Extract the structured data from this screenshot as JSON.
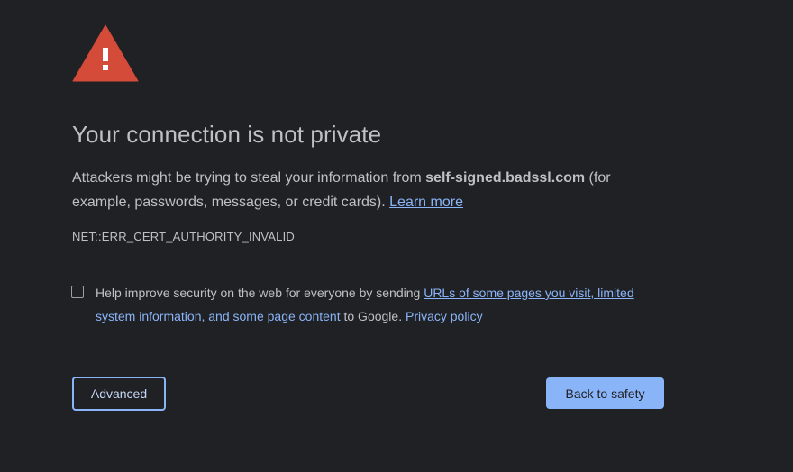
{
  "icon": {
    "name": "warning-triangle-icon",
    "color": "#d44b3a"
  },
  "title": "Your connection is not private",
  "message": {
    "before": "Attackers might be trying to steal your information from ",
    "host": "self-signed.badssl.com",
    "after": " (for example, passwords, messages, or credit cards). ",
    "learn_more": "Learn more"
  },
  "error_code": "NET::ERR_CERT_AUTHORITY_INVALID",
  "optin": {
    "checked": false,
    "text_before": "Help improve security on the web for everyone by sending ",
    "link_urls": "URLs of some pages you visit, limited system information, and some page content",
    "text_middle": " to Google. ",
    "link_privacy": "Privacy policy"
  },
  "buttons": {
    "advanced": "Advanced",
    "back_to_safety": "Back to safety"
  },
  "colors": {
    "background": "#202124",
    "text": "#bdc1c6",
    "link": "#8ab4f8",
    "primary_button": "#8ab4f8"
  }
}
